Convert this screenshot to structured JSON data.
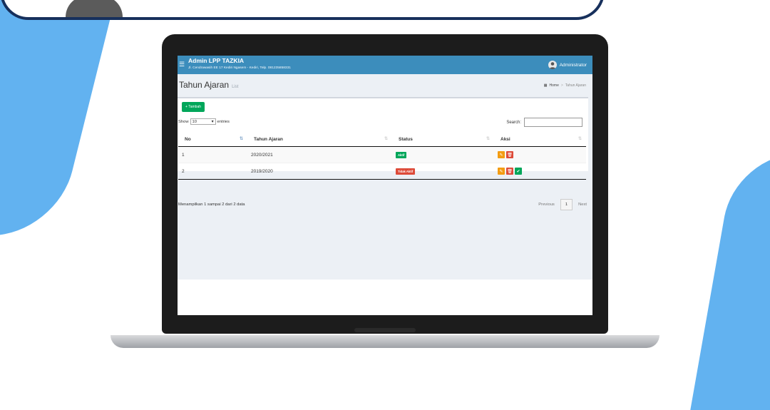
{
  "colors": {
    "accent": "#3c8dbc",
    "success": "#00a65a",
    "danger": "#dd4b39",
    "warning": "#f39c12",
    "background_shape": "#62b2f0"
  },
  "header": {
    "brand": "Admin LPP TAZKIA",
    "address": "Jl. Cendrawasih EE 17 Kediri Ngasem - Kediri, Telp. 081235858331",
    "user_name": "Administrator",
    "menu_icon": "hamburger-icon",
    "avatar_icon": "user-avatar-icon"
  },
  "page": {
    "title": "Tahun Ajaran",
    "subtitle": "List",
    "breadcrumb": {
      "home": "Home",
      "current": "Tahun Ajaran"
    }
  },
  "toolbar": {
    "add_label": "Tambah"
  },
  "table_controls": {
    "show_label": "Show",
    "page_size": "10",
    "entries_label": "entries",
    "search_label": "Search:"
  },
  "table": {
    "columns": [
      "No",
      "Tahun Ajaran",
      "Status",
      "Aksi"
    ],
    "rows": [
      {
        "no": "1",
        "tahun": "2020/2021",
        "status": "Aktif"
      },
      {
        "no": "2",
        "tahun": "2019/2020",
        "status": "Tidak Aktif"
      }
    ]
  },
  "pagination": {
    "info": "Menampilkan 1 sampai 2 dari 2 data",
    "previous": "Previous",
    "current_page": "1",
    "next": "Next"
  }
}
